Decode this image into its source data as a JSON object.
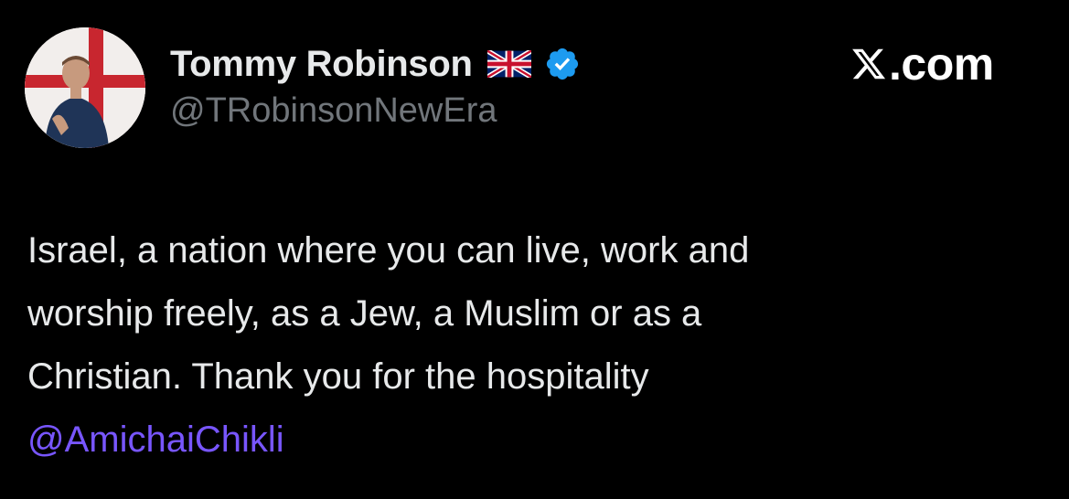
{
  "user": {
    "display_name": "Tommy Robinson",
    "handle": "@TRobinsonNewEra",
    "flag_icon": "uk-flag-icon",
    "verified_icon": "verified-badge-icon",
    "verified_color": "#1d9bf0"
  },
  "brand": {
    "icon": "x-logo-icon",
    "label": ".com"
  },
  "tweet": {
    "lines": [
      "Israel, a nation where you can live, work and",
      "worship freely, as a Jew, a Muslim or as a",
      "Christian. Thank you for the hospitality"
    ],
    "mention": "@AmichaiChikli",
    "mention_color": "#7856ff"
  },
  "colors": {
    "background": "#000000",
    "text_primary": "#e7e9ea",
    "text_secondary": "#71767b"
  }
}
